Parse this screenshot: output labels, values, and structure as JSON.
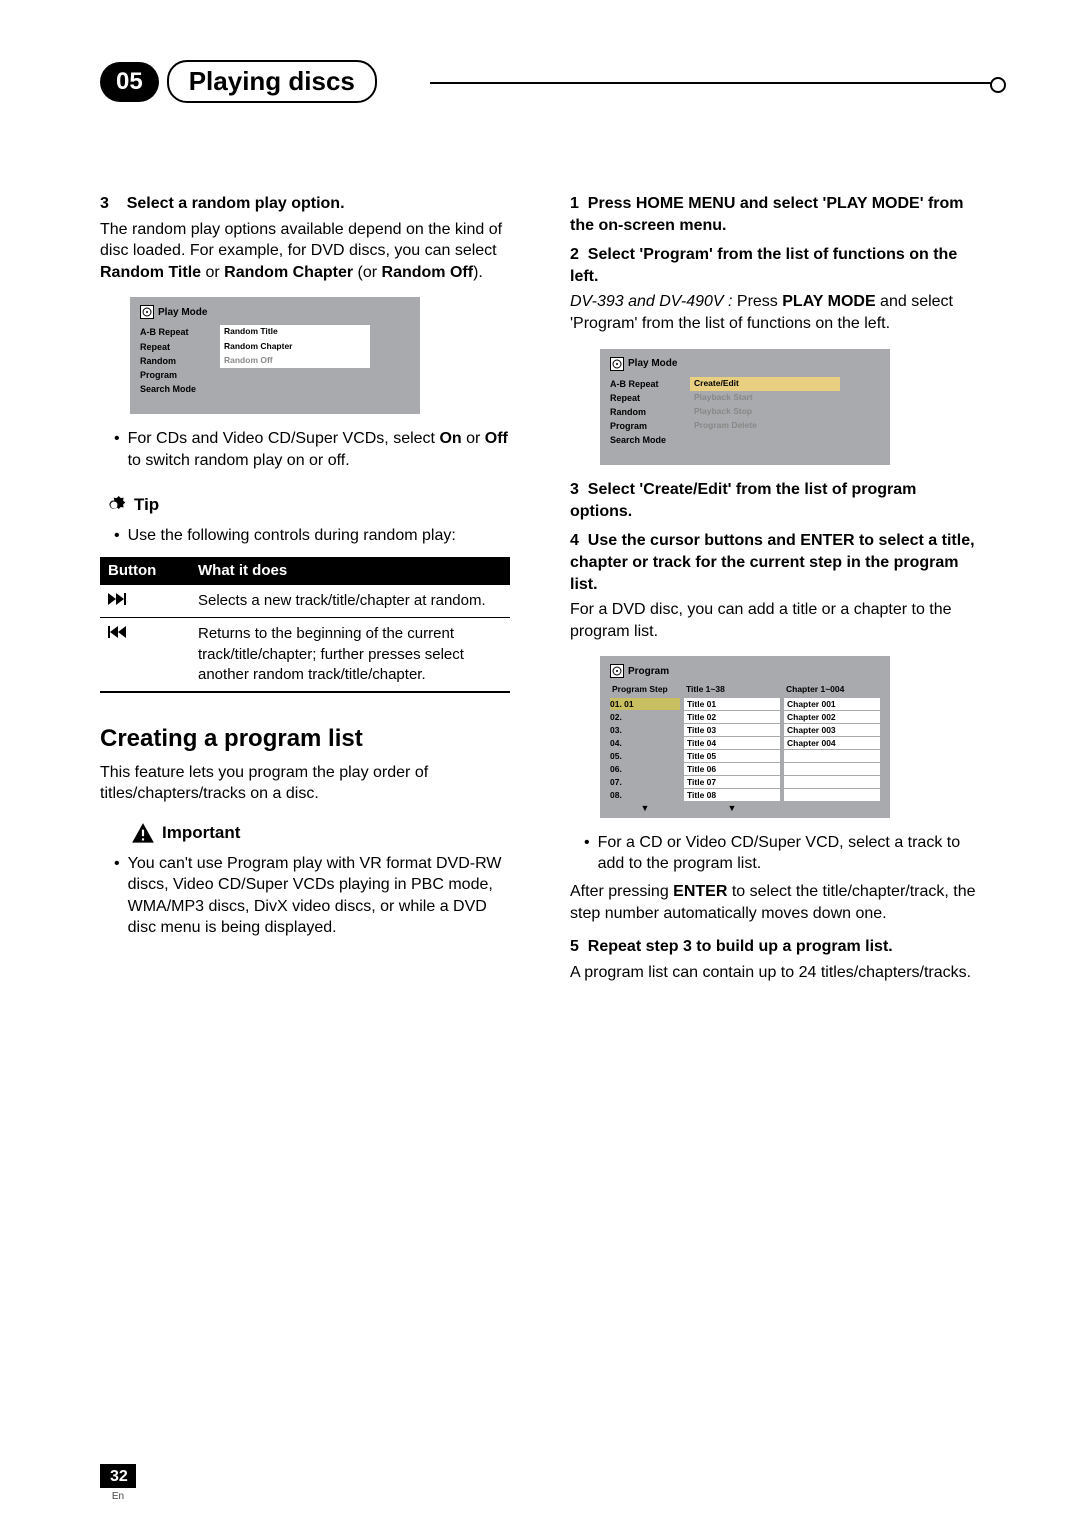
{
  "chapter": {
    "num": "05",
    "title": "Playing discs"
  },
  "left": {
    "step3": {
      "num": "3",
      "title": "Select a random play option.",
      "body1": "The random play options available depend on the kind of disc loaded. For example, for DVD discs, you can select ",
      "b1": "Random Title",
      "mid1": " or ",
      "b2": "Random Chapter",
      "mid2": " (or ",
      "b3": "Random Off",
      "end": ")."
    },
    "osd1": {
      "header": "Play Mode",
      "rows": [
        {
          "l": "A-B Repeat",
          "r": "Random Title",
          "dim": false
        },
        {
          "l": "Repeat",
          "r": "Random Chapter",
          "dim": false
        },
        {
          "l": "Random",
          "r": "Random Off",
          "dim": true
        },
        {
          "l": "Program",
          "r": "",
          "dim": false
        },
        {
          "l": "Search Mode",
          "r": "",
          "dim": false
        }
      ]
    },
    "bullet_cd": {
      "pre": "For CDs and Video CD/Super VCDs, select ",
      "b1": "On",
      "mid": " or ",
      "b2": "Off",
      "post": " to switch random play on or off."
    },
    "tip": {
      "label": "Tip",
      "body": "Use the following controls during random play:"
    },
    "table": {
      "h1": "Button",
      "h2": "What it does",
      "r1": "Selects a new track/title/chapter at random.",
      "r2": "Returns to the beginning of the current track/title/chapter; further presses select another random track/title/chapter."
    },
    "h2": "Creating a program list",
    "h2_body": "This feature lets you program the play order of titles/chapters/tracks on a disc.",
    "imp": {
      "label": "Important",
      "body": "You can't use Program play with VR format DVD-RW discs, Video CD/Super VCDs playing in PBC mode, WMA/MP3 discs, DivX video discs, or while a DVD disc menu is being displayed."
    }
  },
  "right": {
    "step1": {
      "num": "1",
      "title": "Press HOME MENU and select 'PLAY MODE' from the on-screen menu."
    },
    "step2": {
      "num": "2",
      "title": "Select 'Program' from the list of functions on the left.",
      "note_i": "DV-393 and DV-490V : ",
      "note_pre": "Press ",
      "note_b": "PLAY MODE",
      "note_post": " and select 'Program' from the list of functions on the left."
    },
    "osd2": {
      "header": "Play Mode",
      "rows": [
        {
          "l": "A-B Repeat",
          "r": "Create/Edit",
          "hl": true
        },
        {
          "l": "Repeat",
          "r": "Playback Start",
          "dim": true
        },
        {
          "l": "Random",
          "r": "Playback Stop",
          "dim": true
        },
        {
          "l": "Program",
          "r": "Program Delete",
          "dim": true
        },
        {
          "l": "Search Mode",
          "r": "",
          "dim": false
        }
      ]
    },
    "step3": {
      "num": "3",
      "title": "Select 'Create/Edit' from the list of program options."
    },
    "step4": {
      "num": "4",
      "title": "Use the cursor buttons and ENTER to select a title, chapter or track for the current step in the program list.",
      "body": "For a DVD disc, you can add a title or a chapter to the program list."
    },
    "prog": {
      "header": "Program",
      "col1_h": "Program Step",
      "col2_h": "Title 1~38",
      "col3_h": "Chapter 1~004",
      "steps": [
        "01. 01",
        "02.",
        "03.",
        "04.",
        "05.",
        "06.",
        "07.",
        "08."
      ],
      "titles": [
        "Title 01",
        "Title 02",
        "Title 03",
        "Title 04",
        "Title 05",
        "Title 06",
        "Title 07",
        "Title 08"
      ],
      "chapters": [
        "Chapter 001",
        "Chapter 002",
        "Chapter 003",
        "Chapter 004",
        "",
        "",
        "",
        ""
      ]
    },
    "bullet_cd2": "For a CD or Video CD/Super VCD, select a track to add to the program list.",
    "after_enter": {
      "pre": "After pressing ",
      "b": "ENTER",
      "post": " to select the title/chapter/track, the step number automatically moves down one."
    },
    "step5": {
      "num": "5",
      "title": "Repeat step 3 to build up a program list.",
      "body": "A program list can contain up to 24 titles/chapters/tracks."
    }
  },
  "page": {
    "num": "32",
    "lang": "En"
  }
}
